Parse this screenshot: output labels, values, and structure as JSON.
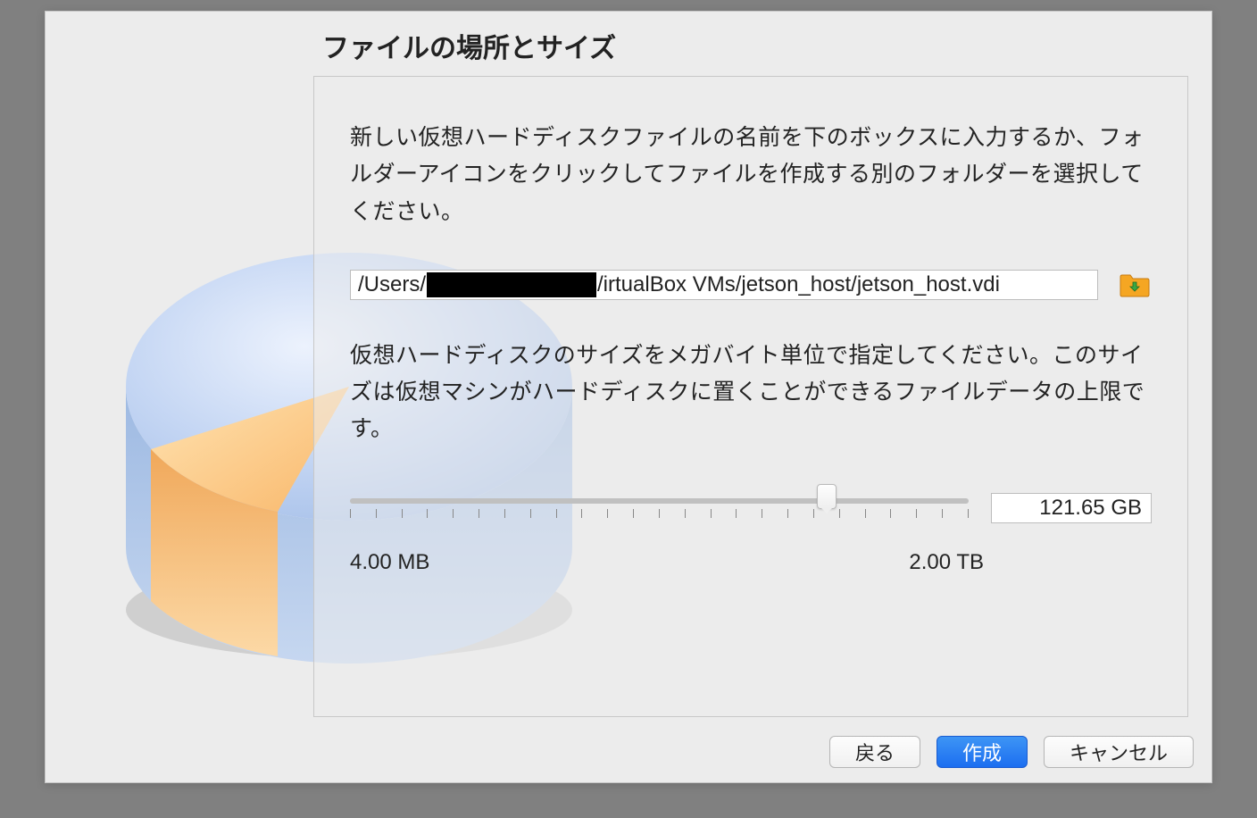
{
  "dialog": {
    "title": "ファイルの場所とサイズ",
    "instruction1": "新しい仮想ハードディスクファイルの名前を下のボックスに入力するか、フォルダーアイコンをクリックしてファイルを作成する別のフォルダーを選択してください。",
    "instruction2": "仮想ハードディスクのサイズをメガバイト単位で指定してください。このサイズは仮想マシンがハードディスクに置くことができるファイルデータの上限です。",
    "path": {
      "prefix": "/Users/",
      "suffix": "/irtualBox VMs/jetson_host/jetson_host.vdi"
    },
    "slider": {
      "min_label": "4.00 MB",
      "max_label": "2.00 TB",
      "value_display": "121.65 GB",
      "thumb_position_percent": 77
    },
    "buttons": {
      "back": "戻る",
      "create": "作成",
      "cancel": "キャンセル"
    }
  }
}
